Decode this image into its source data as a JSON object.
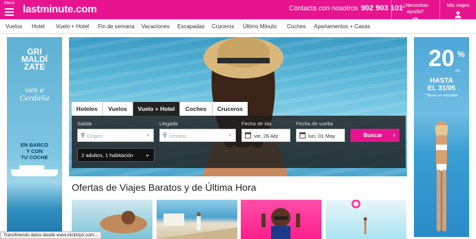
{
  "header": {
    "menu_label": "Menú",
    "logo": "lastminute.com",
    "contact_text": "Contacta con nosotros",
    "contact_phone": "902 903 101",
    "help_label": "¿Necesitas ayuda?",
    "trips_label": "Mis viajes",
    "brand_color": "#e8148f"
  },
  "nav": {
    "items": [
      "Vuelos",
      "Hotel",
      "Vuelo + Hotel",
      "Fin de semana",
      "Vacaciones",
      "Escapadas",
      "Cruceros",
      "Último Minuto",
      "Coches",
      "Apartamentos + Casas"
    ]
  },
  "ad_left": {
    "title_lines": [
      "GRI",
      "MALDÍ",
      "ZATE"
    ],
    "script_lines": [
      "ven a",
      "Cerdeña"
    ],
    "tagline_lines": [
      "EN BARCO",
      "Y CON",
      "TU COCHE"
    ]
  },
  "ad_right": {
    "big": "20",
    "percent": "%",
    "dto": "dto.",
    "until_lines": [
      "HASTA",
      "EL 31/05"
    ],
    "note": "*Tasas no incluidas"
  },
  "search": {
    "tabs": [
      {
        "label": "Hoteles",
        "active": false
      },
      {
        "label": "Vuelos",
        "active": false
      },
      {
        "label": "Vuelo + Hotel",
        "active": true
      },
      {
        "label": "Coches",
        "active": false
      },
      {
        "label": "Cruceros",
        "active": false
      }
    ],
    "origin_label": "Salida",
    "origin_placeholder": "Origen",
    "dest_label": "Llegada",
    "dest_placeholder": "Destino",
    "depart_label": "Fecha de ida",
    "depart_value": "vie, 28 Abr",
    "return_label": "Fecha de vuelta",
    "return_value": "lun, 01 May",
    "search_button": "Buscar",
    "passengers": "2 adultos, 1 habitación"
  },
  "section_title": "Ofertas de Viajes Baratos y de Última Hora",
  "status_text": "Transfiriendo datos desde www.clicktripz.com..."
}
